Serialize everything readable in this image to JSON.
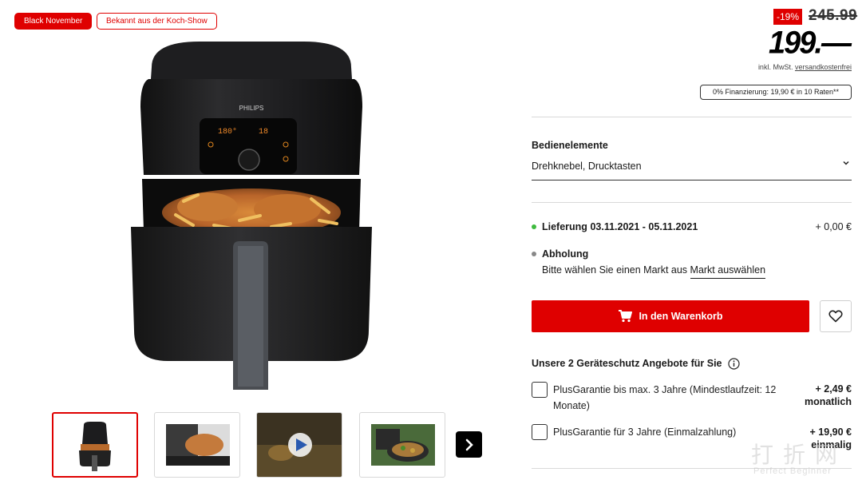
{
  "badges": {
    "black_november": "Black November",
    "koch_show": "Bekannt aus der Koch-Show"
  },
  "product": {
    "brand_on_device": "PHILIPS",
    "display_temp": "180°",
    "display_time": "18"
  },
  "price": {
    "discount": "-19%",
    "old_price": "245.99",
    "current_price": "199.—",
    "note_prefix": "inkl. MwSt. ",
    "note_link": "versandkostenfrei",
    "financing": "0% Finanzierung: 19,90 € in 10 Raten**"
  },
  "controls": {
    "title": "Bedienelemente",
    "selected_value": "Drehknebel, Drucktasten"
  },
  "delivery": {
    "label": "Lieferung",
    "date": "03.11.2021 - 05.11.2021",
    "price": "+ 0,00 €",
    "dot_color": "#3fba3f"
  },
  "pickup": {
    "label": "Abholung",
    "text": "Bitte wählen Sie einen Markt aus",
    "link": "Markt auswählen",
    "dot_color": "#888888"
  },
  "cart": {
    "label": "In den Warenkorb"
  },
  "protection": {
    "title": "Unsere 2 Geräteschutz Angebote für Sie",
    "options": [
      {
        "line1": "PlusGarantie bis max. 3 Jahre (Mindestlaufzeit: 12",
        "line2": "Monate)",
        "price": "+ 2,49 €",
        "price_sub": "monatlich"
      },
      {
        "line1": "PlusGarantie für 3 Jahre (Einmalzahlung)",
        "price": "+ 19,90 €",
        "price_sub": "einmalig"
      }
    ]
  },
  "watermark": {
    "main": "打折网",
    "sub": "Perfect Beginner"
  },
  "colors": {
    "accent": "#df0000"
  }
}
